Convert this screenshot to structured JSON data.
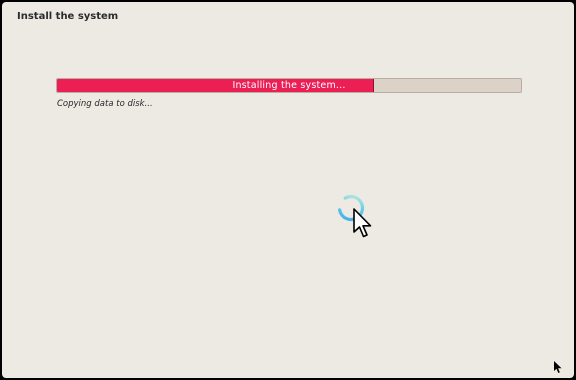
{
  "window": {
    "title": "Install the system"
  },
  "progress": {
    "label": "Installing the system...",
    "fraction": 0.68,
    "fill_color": "#ec1f55",
    "track_color": "#dcd2c8"
  },
  "status": {
    "text": "Copying data to disk..."
  },
  "cursor": {
    "type": "busy",
    "icons": [
      "spinner-icon",
      "arrow-pointer-icon"
    ]
  }
}
